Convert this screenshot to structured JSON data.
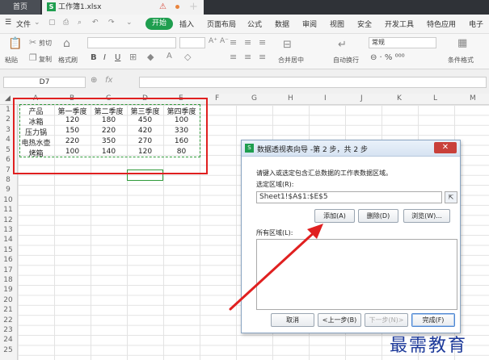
{
  "tabs": {
    "home": "首页",
    "file": "工作簿1.xlsx",
    "add": "+"
  },
  "menu": {
    "file": "文件",
    "start": "开始",
    "items": [
      "插入",
      "页面布局",
      "公式",
      "数据",
      "审阅",
      "视图",
      "安全",
      "开发工具",
      "特色应用",
      "电子"
    ]
  },
  "ribbon": {
    "paste": "粘贴",
    "cut": "剪切",
    "copy": "复制",
    "format_painter": "格式刷",
    "bold": "B",
    "italic": "I",
    "underline": "U",
    "merge_center": "合并居中",
    "wrap": "自动换行",
    "number_format": "常规",
    "cond_format": "条件格式"
  },
  "formula_bar": {
    "name_box": "D7",
    "fx": "fx"
  },
  "columns": [
    "A",
    "B",
    "C",
    "D",
    "E",
    "F",
    "G",
    "H",
    "I",
    "J",
    "K",
    "L",
    "M"
  ],
  "rows": [
    "1",
    "2",
    "3",
    "4",
    "5",
    "6",
    "7",
    "8",
    "9",
    "10",
    "11",
    "12",
    "13",
    "14",
    "15",
    "16",
    "17",
    "18",
    "19",
    "20",
    "21",
    "22",
    "23",
    "24",
    "25"
  ],
  "table": {
    "header": [
      "产品",
      "第一季度",
      "第二季度",
      "第三季度",
      "第四季度"
    ],
    "rows": [
      [
        "冰箱",
        "120",
        "180",
        "450",
        "100"
      ],
      [
        "压力锅",
        "150",
        "220",
        "420",
        "330"
      ],
      [
        "电热水壶",
        "220",
        "350",
        "270",
        "160"
      ],
      [
        "烤箱",
        "100",
        "140",
        "120",
        "80"
      ]
    ]
  },
  "dialog": {
    "title": "数据透视表向导 -第 2 步，共 2 步",
    "instruction": "请键入或选定包含汇总数据的工作表数据区域。",
    "range_label": "选定区域(R):",
    "range_value": "Sheet1!$A$1:$E$5",
    "add": "添加(A)",
    "delete": "删除(D)",
    "browse": "浏览(W)...",
    "all_ranges_label": "所有区域(L):",
    "cancel": "取消",
    "back": "<上一步(B)",
    "next": "下一步(N)>",
    "finish": "完成(F)"
  },
  "watermark": "最需教育",
  "colors": {
    "accent_green": "#1f9e4f",
    "annotation_red": "#e02020",
    "watermark_blue": "#1d3a9a"
  }
}
